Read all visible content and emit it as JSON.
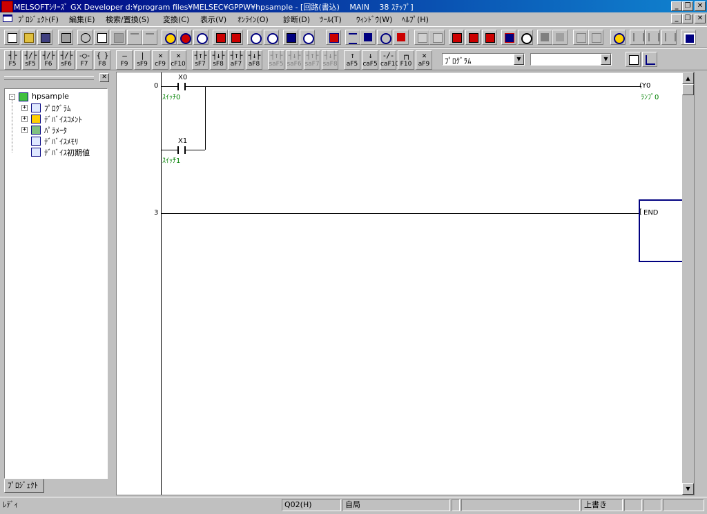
{
  "window": {
    "title": "MELSOFTｼﾘｰｽﾞ GX Developer d:¥program files¥MELSEC¥GPPW¥hpsample - [回路(書込)　  MAIN　 38 ｽﾃｯﾌﾟ]"
  },
  "menu": [
    "ﾌﾟﾛｼﾞｪｸﾄ(F)",
    "編集(E)",
    "検索/置換(S)",
    "変換(C)",
    "表示(V)",
    "ｵﾝﾗｲﾝ(O)",
    "診断(D)",
    "ﾂｰﾙ(T)",
    "ｳｨﾝﾄﾞｳ(W)",
    "ﾍﾙﾌﾟ(H)"
  ],
  "ladder_toolbar": [
    {
      "sym": "┤├",
      "key": "F5"
    },
    {
      "sym": "┤/├",
      "key": "sF5"
    },
    {
      "sym": "┤/├",
      "key": "F6"
    },
    {
      "sym": "┤/├",
      "key": "sF6"
    },
    {
      "sym": "-○-",
      "key": "F7"
    },
    {
      "sym": "{ }",
      "key": "F8"
    },
    {
      "sym": "—",
      "key": "F9"
    },
    {
      "sym": "|",
      "key": "sF9"
    },
    {
      "sym": "✕",
      "key": "cF9"
    },
    {
      "sym": "✕",
      "key": "cF10"
    },
    {
      "sym": "┤↑├",
      "key": "sF7"
    },
    {
      "sym": "┤↓├",
      "key": "sF8"
    },
    {
      "sym": "┤↑├",
      "key": "aF7"
    },
    {
      "sym": "┤↓├",
      "key": "aF8"
    },
    {
      "sym": "┤↑├",
      "key": "saF5"
    },
    {
      "sym": "┤↓├",
      "key": "saF6"
    },
    {
      "sym": "┤↑├",
      "key": "saF7"
    },
    {
      "sym": "┤↓├",
      "key": "saF8"
    },
    {
      "sym": "↑",
      "key": "aF5"
    },
    {
      "sym": "↓",
      "key": "caF5"
    },
    {
      "sym": "-/-",
      "key": "caF10"
    },
    {
      "sym": "┌┐",
      "key": "F10"
    },
    {
      "sym": "✕",
      "key": "aF9"
    }
  ],
  "combo_program": {
    "value": "ﾌﾟﾛｸﾞﾗﾑ"
  },
  "combo_blank": {
    "value": ""
  },
  "project": {
    "tab_label": "ﾌﾟﾛｼﾞｪｸﾄ",
    "root": "hpsample",
    "items": [
      "ﾌﾟﾛｸﾞﾗﾑ",
      "ﾃﾞﾊﾞｲｽｺﾒﾝﾄ",
      "ﾊﾟﾗﾒｰﾀ",
      "ﾃﾞﾊﾞｲｽﾒﾓﾘ",
      "ﾃﾞﾊﾞｲｽ初期値"
    ]
  },
  "ladder": {
    "step0": "0",
    "step3": "3",
    "contact_x0": "X0",
    "contact_x0_comment": "ｽｲｯﾁ0",
    "contact_x1": "X1",
    "contact_x1_comment": "ｽｲｯﾁ1",
    "coil_open": "(Y0",
    "coil_close": ")",
    "coil_comment": "ﾗﾝﾌﾟ0",
    "end_label": "END"
  },
  "status": {
    "ready": "ﾚﾃﾞｨ",
    "cpu": "Q02(H)",
    "station": "自局",
    "mode": "上書き"
  },
  "colors": {
    "title_bar": "#000080",
    "comment": "#008000",
    "selection_box": "#000080"
  }
}
